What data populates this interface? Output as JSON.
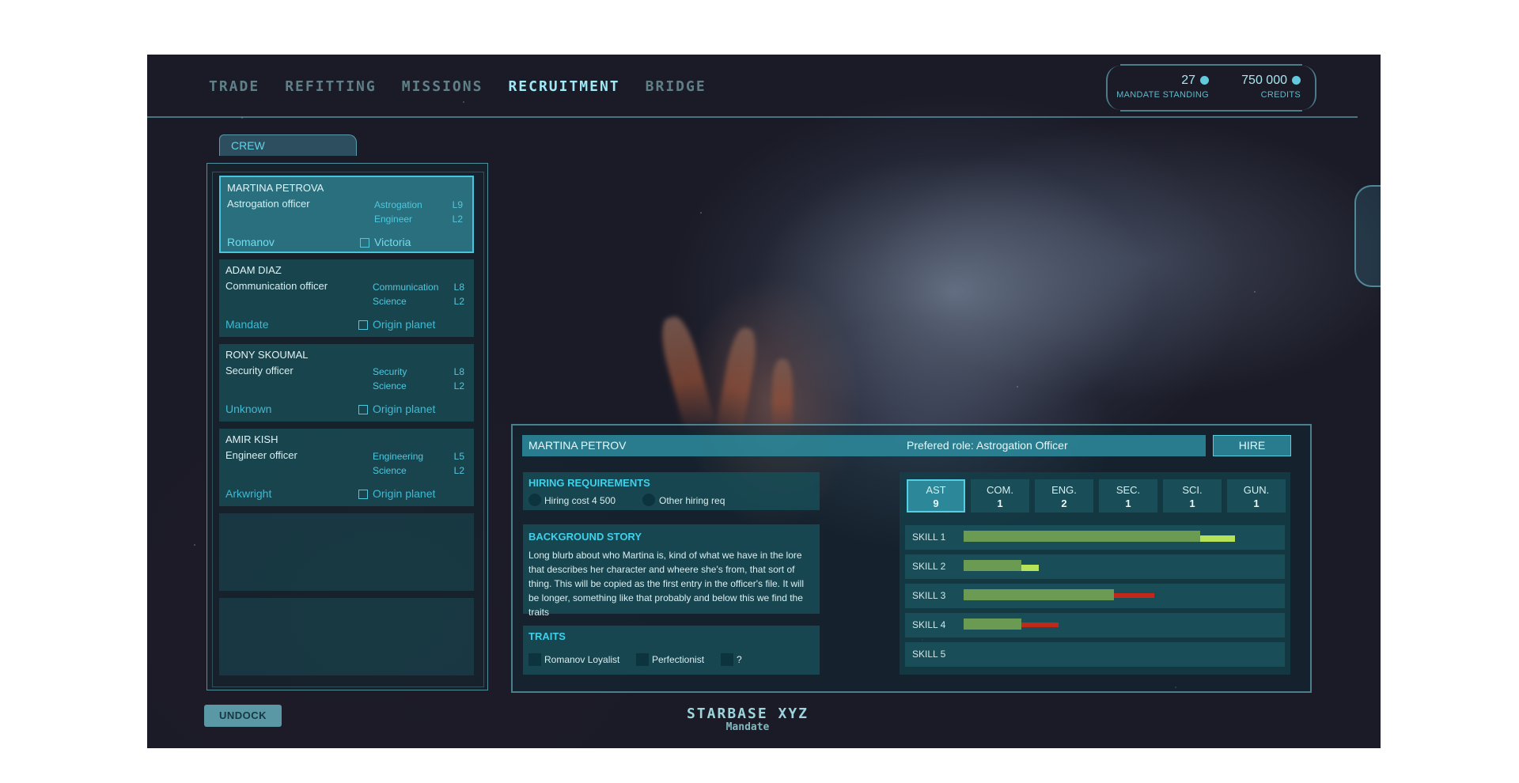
{
  "nav": {
    "tabs": [
      "TRADE",
      "REFITTING",
      "MISSIONS",
      "RECRUITMENT",
      "BRIDGE"
    ],
    "active": "RECRUITMENT"
  },
  "resources": {
    "mandate_standing": {
      "value": "27",
      "label": "MANDATE STANDING"
    },
    "credits": {
      "value": "750 000",
      "label": "CREDITS"
    }
  },
  "crew": {
    "tab_label": "CREW",
    "members": [
      {
        "name": "MARTINA PETROVA",
        "role": "Astrogation officer",
        "skills": [
          {
            "name": "Astrogation",
            "level": "L9"
          },
          {
            "name": "Engineer",
            "level": "L2"
          }
        ],
        "faction": "Romanov",
        "origin": "Victoria",
        "selected": true
      },
      {
        "name": "ADAM DIAZ",
        "role": "Communication officer",
        "skills": [
          {
            "name": "Communication",
            "level": "L8"
          },
          {
            "name": "Science",
            "level": "L2"
          }
        ],
        "faction": "Mandate",
        "origin": "Origin planet",
        "selected": false
      },
      {
        "name": "RONY SKOUMAL",
        "role": "Security officer",
        "skills": [
          {
            "name": "Security",
            "level": "L8"
          },
          {
            "name": "Science",
            "level": "L2"
          }
        ],
        "faction": "Unknown",
        "origin": "Origin planet",
        "selected": false
      },
      {
        "name": "AMIR KISH",
        "role": "Engineer officer",
        "skills": [
          {
            "name": "Engineering",
            "level": "L5"
          },
          {
            "name": "Science",
            "level": "L2"
          }
        ],
        "faction": "Arkwright",
        "origin": "Origin planet",
        "selected": false
      }
    ]
  },
  "footer": {
    "undock_label": "UNDOCK",
    "station_name": "STARBASE XYZ",
    "station_faction": "Mandate"
  },
  "detail": {
    "name": "MARTINA PETROV",
    "preferred_role": "Prefered role: Astrogation Officer",
    "hire_label": "HIRE",
    "hiring_requirements": {
      "title": "HIRING REQUIREMENTS",
      "items": [
        "Hiring cost 4 500",
        "Other hiring req"
      ]
    },
    "background": {
      "title": "BACKGROUND STORY",
      "text": "Long blurb about who Martina is, kind of what we have in the lore that describes her character and wheere she's from, that sort of thing. This will be copied as the first entry in the officer's file. It will be longer, something like that probably and below this we find the traits"
    },
    "traits": {
      "title": "TRAITS",
      "items": [
        "Romanov Loyalist",
        "Perfectionist",
        "?"
      ]
    },
    "stats": [
      {
        "name": "AST",
        "value": "9",
        "selected": true
      },
      {
        "name": "COM.",
        "value": "1",
        "selected": false
      },
      {
        "name": "ENG.",
        "value": "2",
        "selected": false
      },
      {
        "name": "SEC.",
        "value": "1",
        "selected": false
      },
      {
        "name": "SCI.",
        "value": "1",
        "selected": false
      },
      {
        "name": "GUN.",
        "value": "1",
        "selected": false
      }
    ],
    "skills": [
      {
        "label": "SKILL 1",
        "base": 0.82,
        "change": 0.12,
        "change_type": "increase"
      },
      {
        "label": "SKILL 2",
        "base": 0.2,
        "change": 0.06,
        "change_type": "increase"
      },
      {
        "label": "SKILL 3",
        "base": 0.52,
        "change": 0.14,
        "change_type": "decrease"
      },
      {
        "label": "SKILL 4",
        "base": 0.2,
        "change": 0.13,
        "change_type": "decrease"
      },
      {
        "label": "SKILL 5",
        "base": 0,
        "change": 0,
        "change_type": "none"
      }
    ],
    "colors": {
      "base": "#6b9a52",
      "increase": "#b6e25a",
      "decrease": "#c0281a"
    }
  }
}
